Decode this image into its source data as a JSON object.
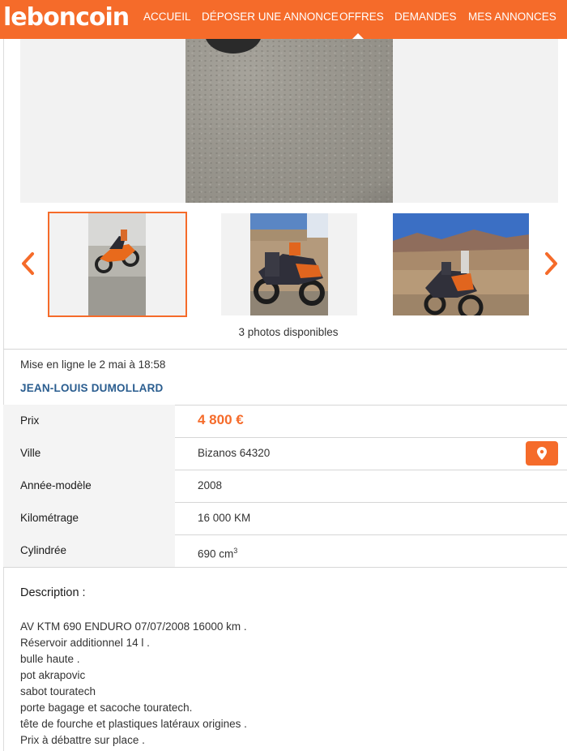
{
  "header": {
    "logo": "leboncoin",
    "nav": [
      {
        "label": "ACCUEIL"
      },
      {
        "label": "DÉPOSER UNE ANNONCE"
      },
      {
        "label": "OFFRES"
      },
      {
        "label": "DEMANDES"
      },
      {
        "label": "MES ANNONCES"
      }
    ],
    "active_nav": "OFFRES"
  },
  "gallery": {
    "photo_count_text": "3 photos disponibles",
    "selected_index": 0,
    "prev_icon": "chevron-left-icon",
    "next_icon": "chevron-right-icon"
  },
  "ad": {
    "posted_text": "Mise en ligne le 2 mai à 18:58",
    "seller_name": "JEAN-LOUIS DUMOLLARD",
    "attributes": [
      {
        "label": "Prix",
        "value": "4 800 €"
      },
      {
        "label": "Ville",
        "value": "Bizanos 64320"
      },
      {
        "label": "Année-modèle",
        "value": "2008"
      },
      {
        "label": "Kilométrage",
        "value": "16 000 KM"
      },
      {
        "label": "Cylindrée",
        "value": "690 cm",
        "value_sup": "3"
      }
    ],
    "map_icon": "map-marker-icon"
  },
  "description": {
    "title": "Description :",
    "lines": [
      "AV KTM 690 ENDURO 07/07/2008 16000 km .",
      "Réservoir additionnel 14 l .",
      "bulle haute .",
      "pot akrapovic",
      "sabot touratech",
      "porte bagage et sacoche touratech.",
      "tête de fourche et plastiques latéraux origines .",
      "Prix à débattre sur place ."
    ]
  },
  "colors": {
    "brand_orange": "#f56b2a",
    "seller_blue": "#2a5d8f",
    "label_bg": "#f4f4f4"
  }
}
